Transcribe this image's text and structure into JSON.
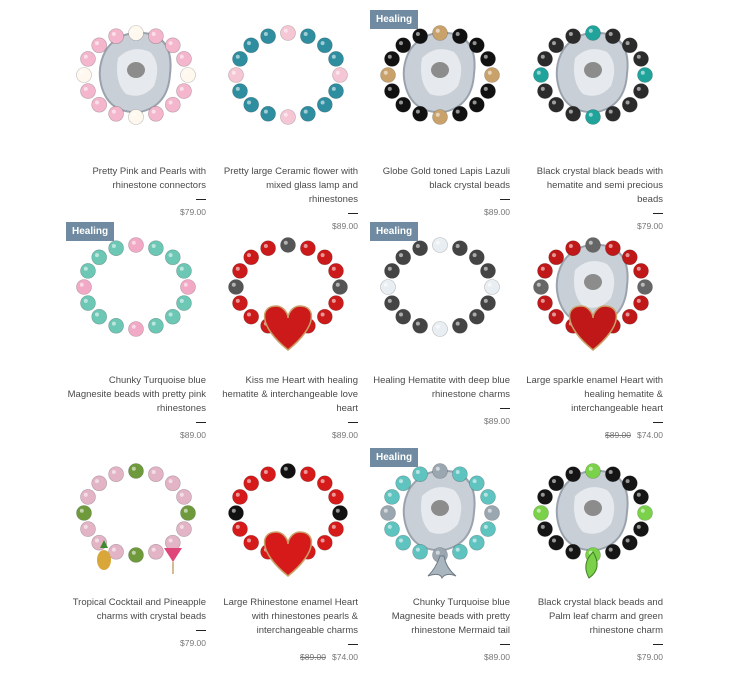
{
  "products": [
    {
      "title": "Pretty Pink and Pearls with rhinestone connectors",
      "price": "$79.00",
      "old_price": "",
      "badge": "",
      "colors": {
        "bead": "#f3b6cc",
        "accent": "#fff8ee"
      }
    },
    {
      "title": "Pretty large Ceramic flower with mixed glass lamp and rhinestones",
      "price": "$89.00",
      "old_price": "",
      "badge": "",
      "colors": {
        "bead": "#2e8ea0",
        "accent": "#f5c6d4"
      }
    },
    {
      "title": "Globe Gold toned Lapis Lazuli black crystal beads",
      "price": "$89.00",
      "old_price": "",
      "badge": "Healing",
      "colors": {
        "bead": "#111111",
        "accent": "#c9a26b"
      }
    },
    {
      "title": "Black crystal black beads with hematite and semi precious beads",
      "price": "$79.00",
      "old_price": "",
      "badge": "",
      "colors": {
        "bead": "#2b2b2b",
        "accent": "#1fa39b"
      }
    },
    {
      "title": "Chunky Turquoise blue Magnesite beads with pretty pink rhinestones",
      "price": "$89.00",
      "old_price": "",
      "badge": "Healing",
      "colors": {
        "bead": "#6cc7b4",
        "accent": "#f1a9c6"
      }
    },
    {
      "title": "Kiss me Heart with healing hematite & interchangeable love heart",
      "price": "$89.00",
      "old_price": "",
      "badge": "",
      "colors": {
        "bead": "#cc1a1a",
        "accent": "#555555"
      }
    },
    {
      "title": "Healing Hematite with deep blue rhinestone charms",
      "price": "$89.00",
      "old_price": "",
      "badge": "Healing",
      "colors": {
        "bead": "#444444",
        "accent": "#e9eef2"
      }
    },
    {
      "title": "Large sparkle enamel Heart with healing hematite & interchangeable heart",
      "price": "$74.00",
      "old_price": "$89.00",
      "badge": "",
      "colors": {
        "bead": "#c01818",
        "accent": "#666666"
      }
    },
    {
      "title": "Tropical Cocktail and Pineapple charms with crystal beads",
      "price": "$79.00",
      "old_price": "",
      "badge": "",
      "colors": {
        "bead": "#e3b4c6",
        "accent": "#6f9a3c"
      }
    },
    {
      "title": "Large Rhinestone enamel Heart with rhinestones pearls & interchangeable charms",
      "price": "$74.00",
      "old_price": "$89.00",
      "badge": "",
      "colors": {
        "bead": "#d61a1a",
        "accent": "#111111"
      }
    },
    {
      "title": "Chunky Turquoise blue Magnesite beads with pretty rhinestone Mermaid tail",
      "price": "$89.00",
      "old_price": "",
      "badge": "Healing",
      "colors": {
        "bead": "#5fc3c0",
        "accent": "#9aa7b0"
      }
    },
    {
      "title": "Black crystal black beads and Palm leaf charm and green rhinestone charm",
      "price": "$79.00",
      "old_price": "",
      "badge": "",
      "colors": {
        "bead": "#151515",
        "accent": "#7bd14a"
      }
    }
  ]
}
